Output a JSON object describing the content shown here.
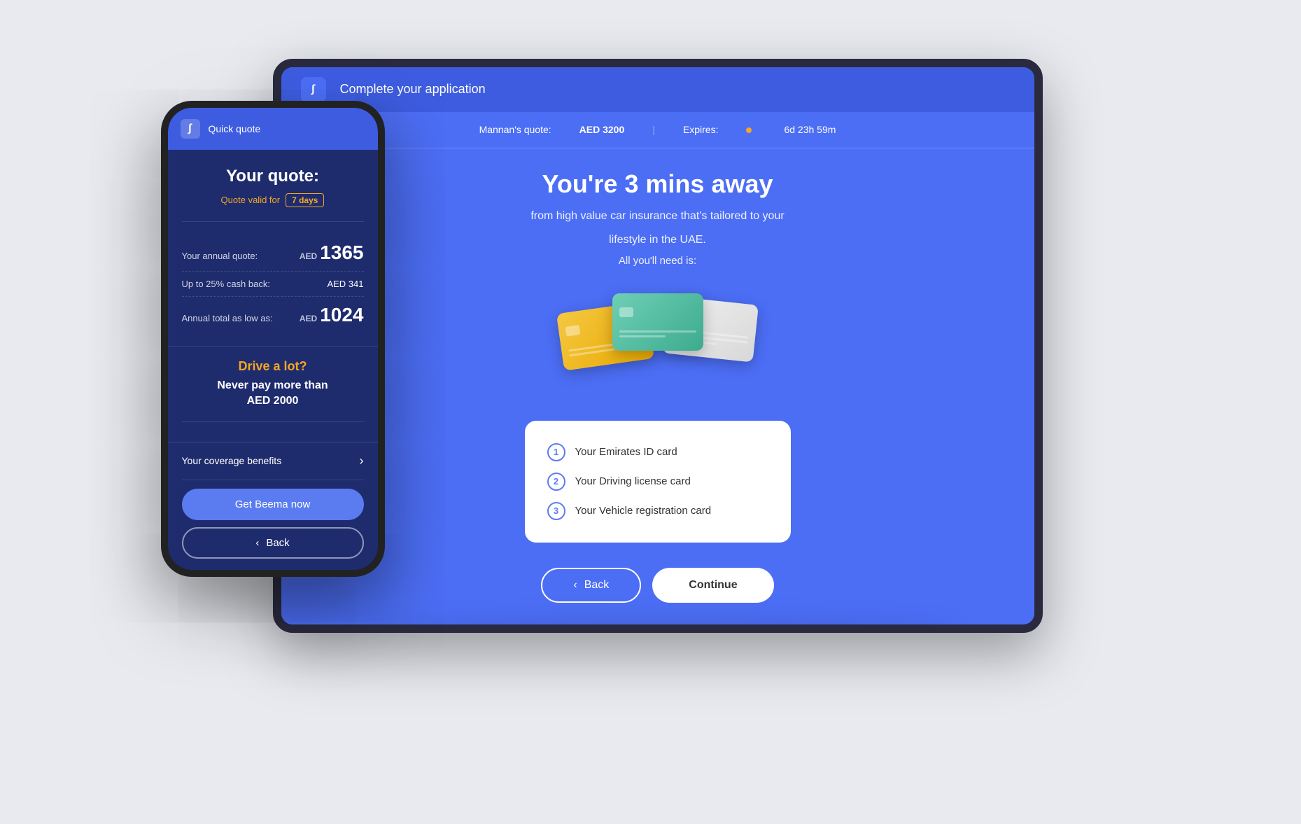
{
  "tablet": {
    "header": {
      "logo": "∫",
      "title": "Complete your application"
    },
    "subheader": {
      "quote_label": "Mannan's quote:",
      "quote_value": "AED 3200",
      "expires_label": "Expires:",
      "expires_value": "6d 23h 59m"
    },
    "content": {
      "heading": "You're 3 mins away",
      "subtext_line1": "from high value car insurance that's tailored to your",
      "subtext_line2": "lifestyle in the UAE.",
      "all_you_need": "All you'll need is:",
      "requirements": [
        {
          "number": "1",
          "text": "Your Emirates ID card"
        },
        {
          "number": "2",
          "text": "Your Driving license card"
        },
        {
          "number": "3",
          "text": "Your Vehicle registration card"
        }
      ],
      "btn_back": "Back",
      "btn_continue": "Continue"
    }
  },
  "phone": {
    "header": {
      "logo": "∫",
      "title": "Quick quote"
    },
    "quote_section": {
      "title": "Your quote:",
      "valid_label": "Quote valid for",
      "valid_badge": "7 days"
    },
    "pricing": [
      {
        "label": "Your annual quote:",
        "prefix": "AED",
        "value": "1365",
        "large": true
      },
      {
        "label": "Up to 25% cash back:",
        "prefix": "",
        "value": "AED 341",
        "large": false
      },
      {
        "label": "Annual total as low as:",
        "prefix": "AED",
        "value": "1024",
        "large": true
      }
    ],
    "promo": {
      "title": "Drive a lot?",
      "text": "Never pay more than\nAED 2000"
    },
    "coverage": {
      "label": "Your coverage benefits",
      "arrow": "›"
    },
    "actions": {
      "primary_btn": "Get Beema now",
      "back_btn": "Back"
    }
  }
}
